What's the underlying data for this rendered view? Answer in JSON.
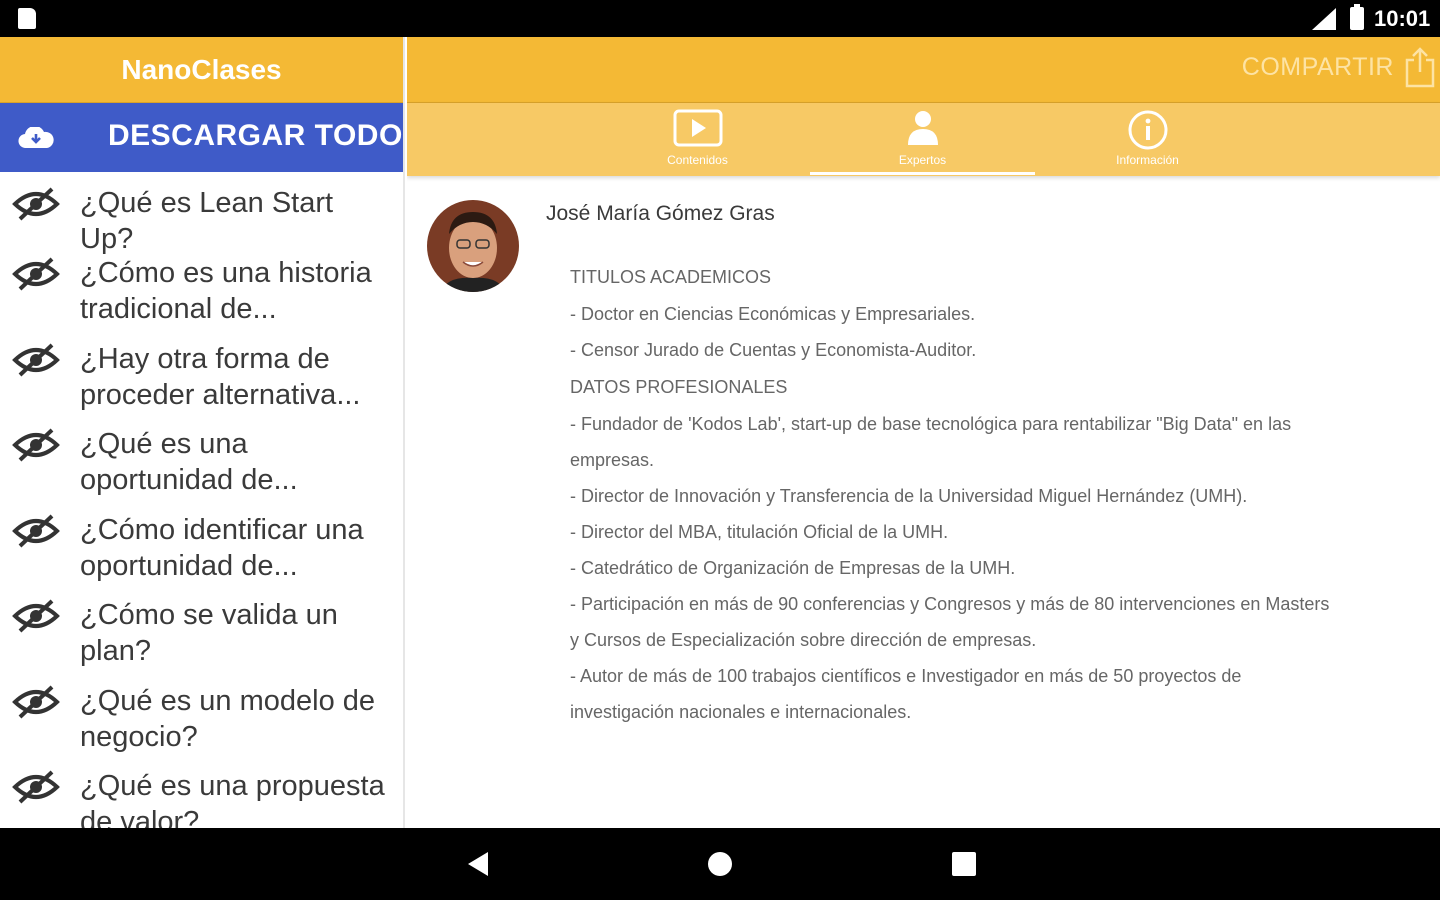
{
  "status_bar": {
    "time": "10:01"
  },
  "sidebar": {
    "app_title": "NanoClases",
    "download_all_label": "DESCARGAR TODO",
    "lessons": [
      "¿Qué es Lean Start Up?",
      "¿Cómo es una historia tradicional de...",
      "¿Hay otra forma de proceder alternativa...",
      "¿Qué es una oportunidad de...",
      "¿Cómo identificar una oportunidad de...",
      "¿Cómo se valida un plan?",
      "¿Qué es un modelo de negocio?",
      "¿Qué es una propuesta de valor?"
    ]
  },
  "appbar": {
    "share_label": "COMPARTIR"
  },
  "tabs": [
    {
      "label": "Contenidos",
      "icon": "play-icon",
      "active": false
    },
    {
      "label": "Expertos",
      "icon": "person-icon",
      "active": true
    },
    {
      "label": "Información",
      "icon": "info-icon",
      "active": false
    }
  ],
  "expert": {
    "name": "José María Gómez Gras",
    "bio": [
      {
        "type": "heading",
        "text": "TITULOS ACADEMICOS"
      },
      {
        "type": "item",
        "text": "- Doctor en Ciencias Económicas y Empresariales."
      },
      {
        "type": "item",
        "text": "- Censor Jurado de Cuentas y Economista-Auditor."
      },
      {
        "type": "heading",
        "text": "DATOS PROFESIONALES"
      },
      {
        "type": "item",
        "text": "- Fundador de 'Kodos Lab', start-up de base tecnológica para rentabilizar \"Big Data\" en las empresas."
      },
      {
        "type": "item",
        "text": "- Director de Innovación y Transferencia de la Universidad Miguel Hernández (UMH)."
      },
      {
        "type": "item",
        "text": "- Director del MBA, titulación Oficial de la UMH."
      },
      {
        "type": "item",
        "text": "- Catedrático de Organización de Empresas de la UMH."
      },
      {
        "type": "item",
        "text": "- Participación en más de 90 conferencias y Congresos y más de 80 intervenciones en Masters y Cursos de Especialización sobre dirección de empresas."
      },
      {
        "type": "item",
        "text": "- Autor de más de 100 trabajos científicos e Investigador en más de 50 proyectos de investigación nacionales e internacionales."
      }
    ]
  },
  "colors": {
    "primary": "#f4b935",
    "tab_bar": "#f7c965",
    "accent_blue": "#3f5bc8"
  }
}
